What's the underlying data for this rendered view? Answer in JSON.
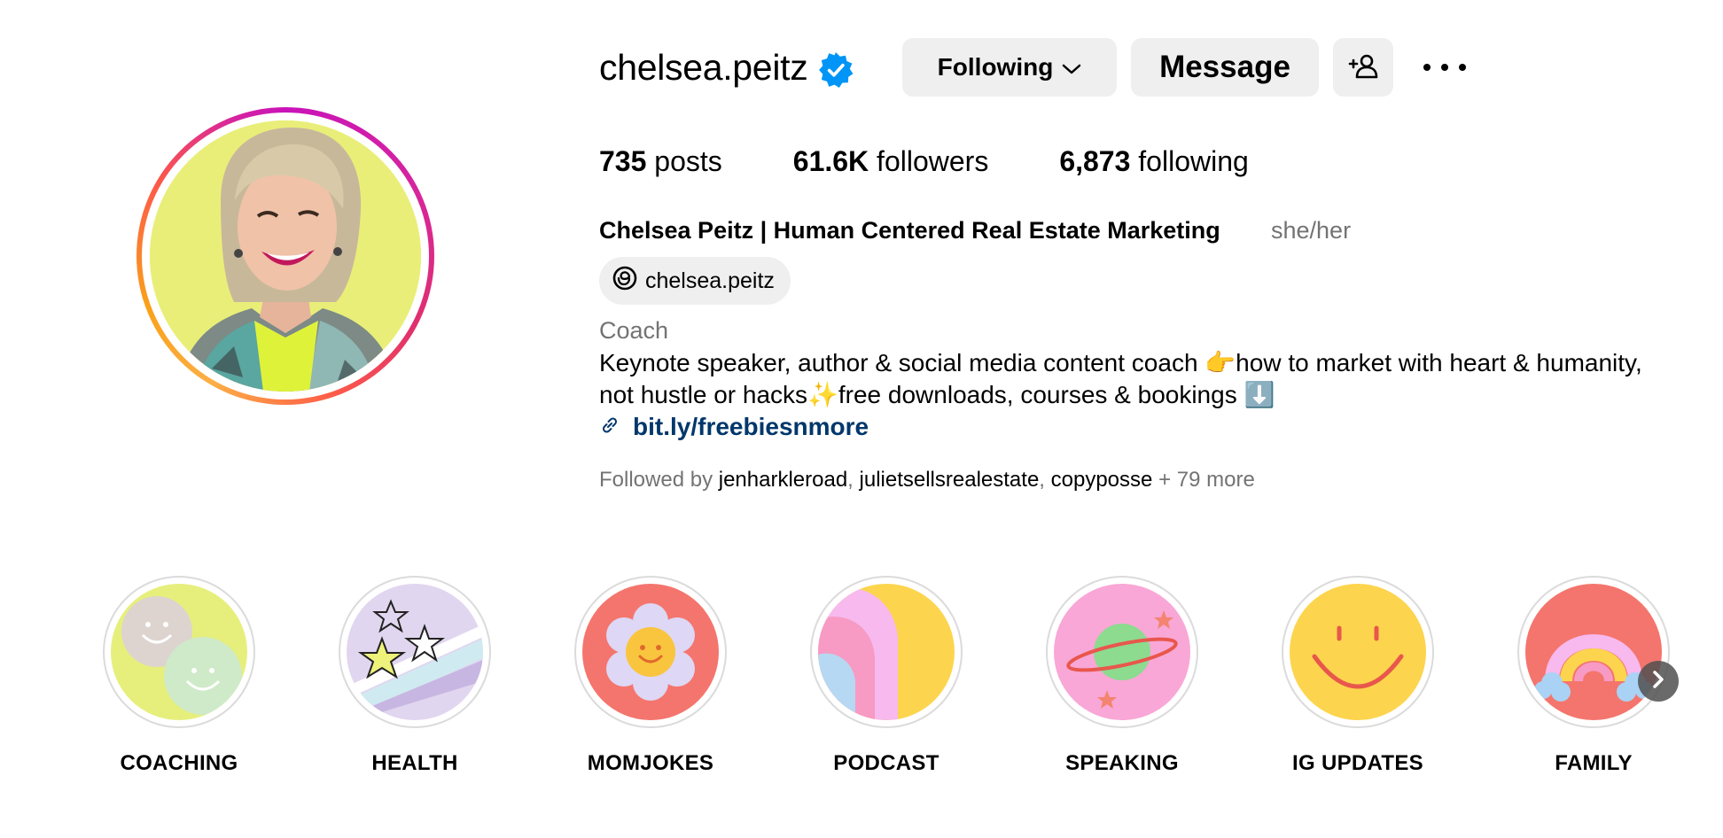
{
  "profile": {
    "username": "chelsea.peitz",
    "verified": true,
    "full_name": "Chelsea Peitz | Human Centered Real Estate Marketing",
    "pronouns": "she/her",
    "threads_handle": "chelsea.peitz",
    "category": "Coach",
    "bio_lines": [
      "Keynote speaker, author & social media content coach 👉how to market with heart & humanity,",
      "not hustle or hacks✨free downloads, courses & bookings ⬇️"
    ],
    "link": "bit.ly/freebiesnmore",
    "followed_by_prefix": "Followed by",
    "followed_by": [
      "jenharkleroad",
      "julietsellsrealestate",
      "copyposse"
    ],
    "followed_by_more": "+ 79 more"
  },
  "stats": {
    "posts_count": "735",
    "posts_label": "posts",
    "followers_count": "61.6K",
    "followers_label": "followers",
    "following_count": "6,873",
    "following_label": "following"
  },
  "actions": {
    "following_label": "Following",
    "message_label": "Message"
  },
  "icons": {
    "verified": "verified-badge-icon",
    "dropdown": "chevron-down-icon",
    "add_user": "add-user-icon",
    "more": "more-options-icon",
    "threads": "threads-icon",
    "link": "link-icon",
    "next": "chevron-right-icon"
  },
  "colors": {
    "verified_blue": "#0095f6",
    "link_text": "#00376b",
    "secondary_text": "#737373",
    "button_bg": "#efefef"
  },
  "highlights": [
    {
      "label": "COACHING"
    },
    {
      "label": "HEALTH"
    },
    {
      "label": "MOMJOKES"
    },
    {
      "label": "PODCAST"
    },
    {
      "label": "SPEAKING"
    },
    {
      "label": "IG UPDATES"
    },
    {
      "label": "FAMILY"
    }
  ]
}
